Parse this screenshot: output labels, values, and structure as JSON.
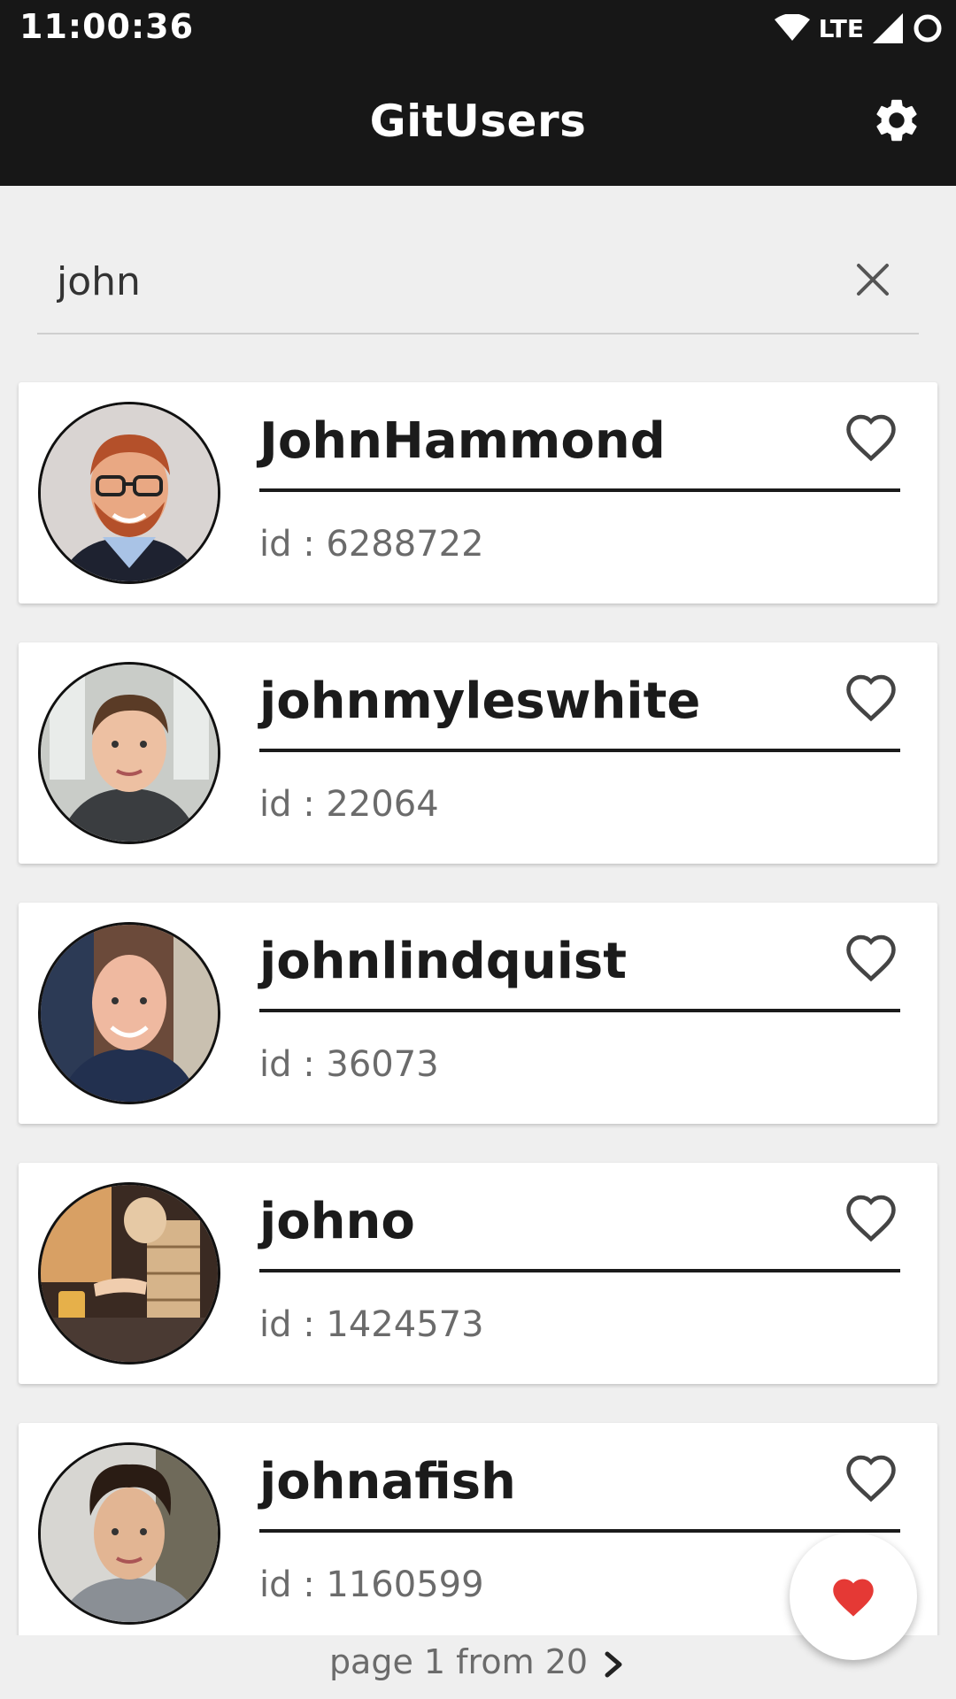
{
  "status_bar": {
    "time": "11:00:36",
    "network": "LTE",
    "icons": [
      "wifi-icon",
      "cell-signal-icon",
      "circle-status-icon"
    ]
  },
  "app_bar": {
    "title": "GitUsers",
    "settings_icon": "gear-icon"
  },
  "search": {
    "value": "john",
    "clear_icon": "close-icon"
  },
  "users": [
    {
      "login": "JohnHammond",
      "id_text": "id : 6288722",
      "favorite_icon": "heart-outline-icon"
    },
    {
      "login": "johnmyleswhite",
      "id_text": "id : 22064",
      "favorite_icon": "heart-outline-icon"
    },
    {
      "login": "johnlindquist",
      "id_text": "id : 36073",
      "favorite_icon": "heart-outline-icon"
    },
    {
      "login": "johno",
      "id_text": "id : 1424573",
      "favorite_icon": "heart-outline-icon"
    },
    {
      "login": "johnafish",
      "id_text": "id : 1160599",
      "favorite_icon": "heart-outline-icon"
    }
  ],
  "pagination": {
    "text": "page 1 from 20",
    "next_icon": "chevron-right-icon"
  },
  "fab": {
    "icon": "heart-filled-icon",
    "color": "#e53935"
  },
  "colors": {
    "app_bar": "#171717",
    "background": "#efefef",
    "card": "#ffffff"
  }
}
